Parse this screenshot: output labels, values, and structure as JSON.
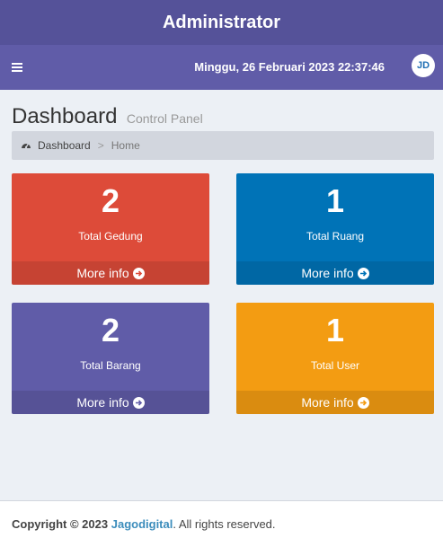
{
  "app": {
    "title": "Administrator"
  },
  "navbar": {
    "datetime": "Minggu, 26 Februari 2023 22:37:46",
    "avatar_text": "JD"
  },
  "header": {
    "title": "Dashboard",
    "subtitle": "Control Panel"
  },
  "breadcrumb": {
    "items": [
      "Dashboard",
      "Home"
    ],
    "separator": ">"
  },
  "boxes": [
    {
      "value": "2",
      "label": "Total Gedung",
      "link": "More info",
      "color": "#dd4b39"
    },
    {
      "value": "1",
      "label": "Total Ruang",
      "link": "More info",
      "color": "#0073b7"
    },
    {
      "value": "2",
      "label": "Total Barang",
      "link": "More info",
      "color": "#605ca8"
    },
    {
      "value": "1",
      "label": "Total User",
      "link": "More info",
      "color": "#f39c12"
    }
  ],
  "footer": {
    "copyright": "Copyright © 2023",
    "company": "Jagodigital",
    "rights": ". All rights reserved."
  }
}
